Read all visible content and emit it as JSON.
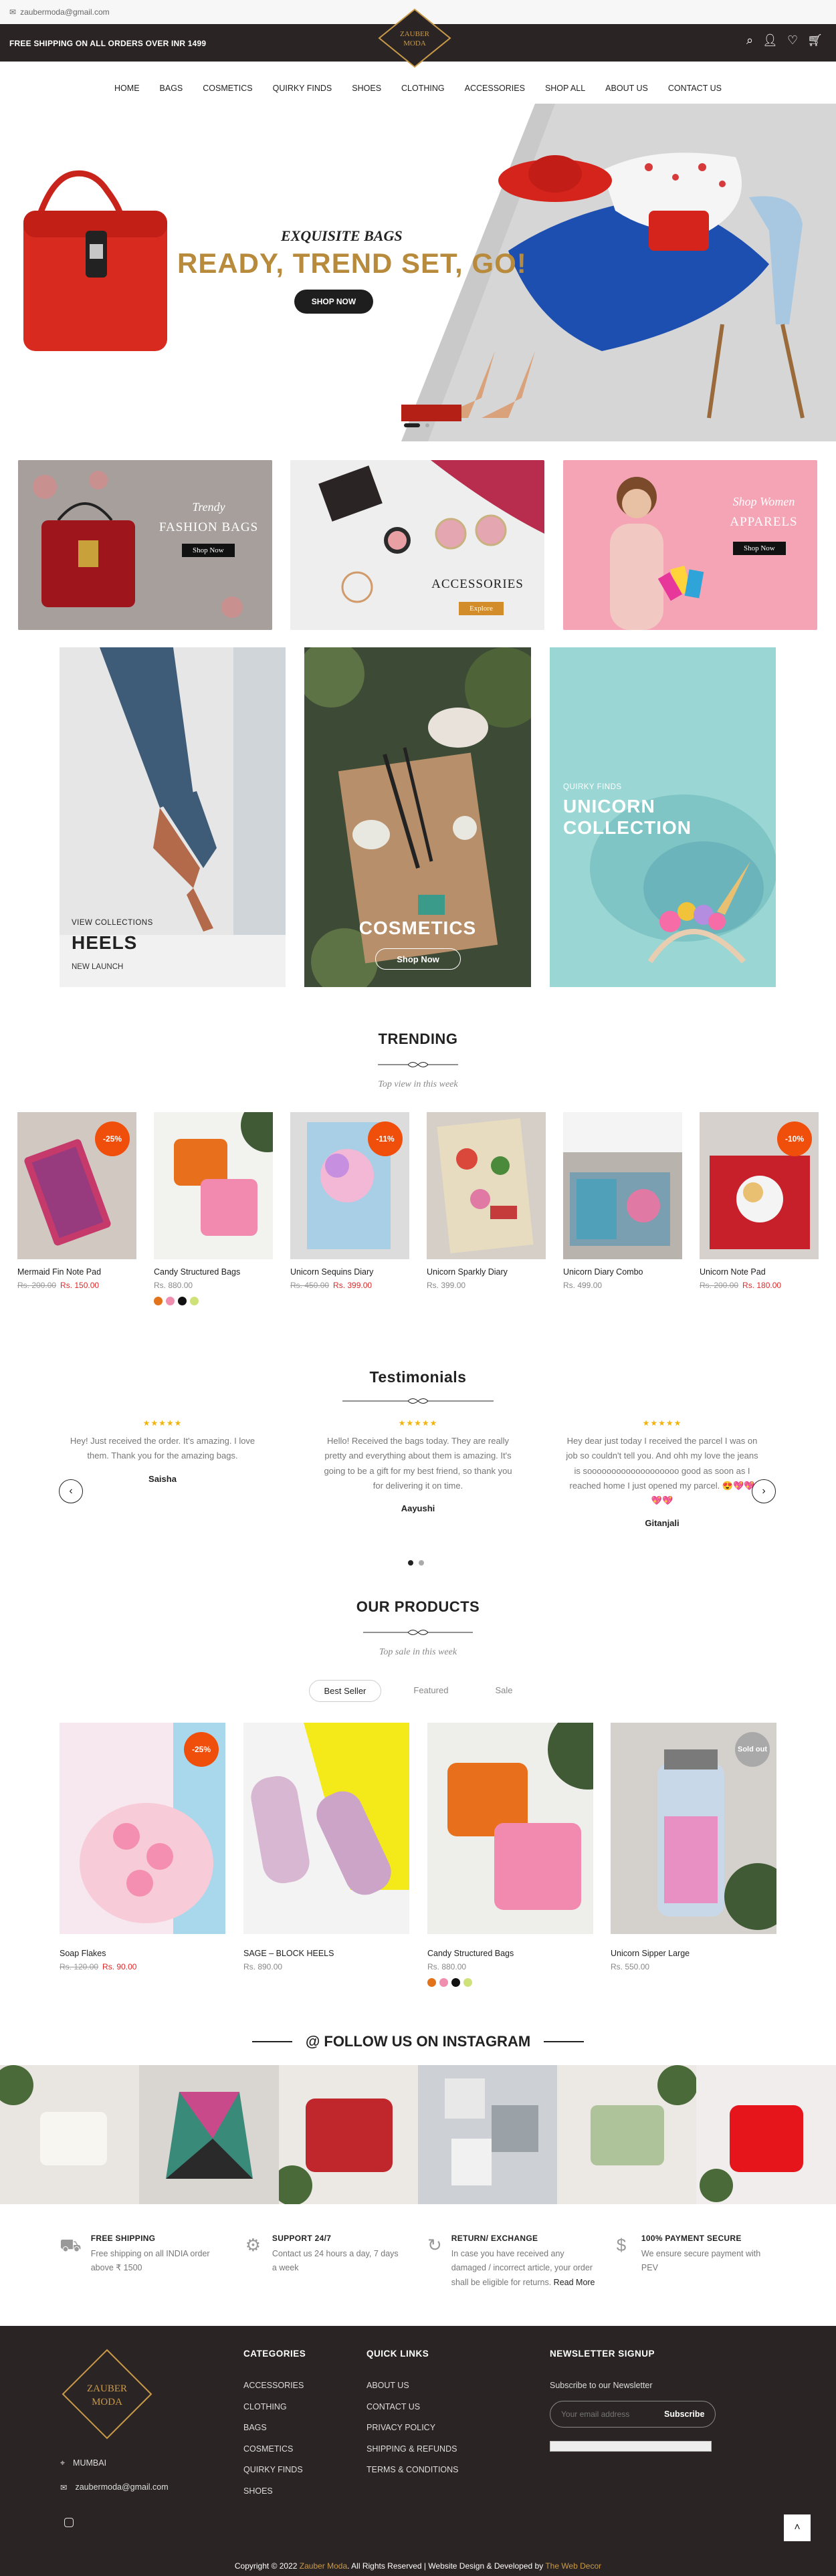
{
  "topbar": {
    "email": "zaubermoda@gmail.com"
  },
  "header": {
    "shipping": "FREE SHIPPING ON ALL ORDERS OVER INR 1499",
    "logo_line1": "ZAUBER",
    "logo_line2": "MODA",
    "wishlist_count": "0",
    "cart_count": "0"
  },
  "nav": [
    "HOME",
    "BAGS",
    "COSMETICS",
    "QUIRKY FINDS",
    "SHOES",
    "CLOTHING",
    "ACCESSORIES",
    "SHOP ALL",
    "ABOUT US",
    "CONTACT US"
  ],
  "hero": {
    "subtitle": "EXQUISITE BAGS",
    "title": "READY, TREND SET, GO!",
    "button": "SHOP NOW"
  },
  "banners": [
    {
      "script": "Trendy",
      "title": "FASHION BAGS",
      "button": "Shop Now"
    },
    {
      "title": "ACCESSORIES",
      "button": "Explore"
    },
    {
      "script": "Shop Women",
      "title": "APPARELS",
      "button": "Shop Now"
    }
  ],
  "tiles": [
    {
      "kicker": "VIEW COLLECTIONS",
      "title": "HEELS",
      "sub": "NEW LAUNCH"
    },
    {
      "title": "COSMETICS",
      "button": "Shop Now"
    },
    {
      "kicker": "QUIRKY FINDS",
      "title1": "UNICORN",
      "title2": "COLLECTION"
    }
  ],
  "trending": {
    "title": "TRENDING",
    "subtitle": "Top view in this week",
    "products": [
      {
        "name": "Mermaid Fin Note Pad",
        "old": "Rs. 200.00",
        "price": "Rs. 150.00",
        "badge": "-25%"
      },
      {
        "name": "Candy Structured Bags",
        "price": "Rs. 880.00",
        "swatches": [
          "#e2731b",
          "#f08eb0",
          "#111111",
          "#cfe27a"
        ]
      },
      {
        "name": "Unicorn Sequins Diary",
        "old": "Rs. 450.00",
        "price": "Rs. 399.00",
        "badge": "-11%"
      },
      {
        "name": "Unicorn Sparkly Diary",
        "price": "Rs. 399.00"
      },
      {
        "name": "Unicorn Diary Combo",
        "price": "Rs. 499.00"
      },
      {
        "name": "Unicorn Note Pad",
        "old": "Rs. 200.00",
        "price": "Rs. 180.00",
        "badge": "-10%"
      }
    ]
  },
  "testimonials": {
    "title": "Testimonials",
    "items": [
      {
        "text": "Hey! Just received the order. It's amazing. I love them. Thank you for the amazing bags.",
        "name": "Saisha"
      },
      {
        "text": "Hello! Received the bags today. They are really pretty and everything about them is amazing. It's going to be a gift for my best friend, so thank you for delivering it on time.",
        "name": "Aayushi"
      },
      {
        "text": "Hey dear just today I received the parcel I was on job so couldn't tell you. And ohh my love the jeans is sooooooooooooooooooo good as soon as I reached home I just opened my parcel. 😍💖💖💖💖",
        "name": "Gitanjali"
      }
    ]
  },
  "our_products": {
    "title": "OUR PRODUCTS",
    "subtitle": "Top sale in this week",
    "tabs": [
      "Best Seller",
      "Featured",
      "Sale"
    ],
    "products": [
      {
        "name": "Soap Flakes",
        "old": "Rs. 120.00",
        "price": "Rs. 90.00",
        "badge": "-25%"
      },
      {
        "name": "SAGE – BLOCK HEELS",
        "price": "Rs. 890.00"
      },
      {
        "name": "Candy Structured Bags",
        "price": "Rs. 880.00",
        "swatches": [
          "#e2731b",
          "#f08eb0",
          "#111111",
          "#cfe27a"
        ]
      },
      {
        "name": "Unicorn Sipper Large",
        "price": "Rs. 550.00",
        "badge": "Sold out"
      }
    ]
  },
  "instagram": {
    "title": "@ FOLLOW US ON INSTAGRAM"
  },
  "features": [
    {
      "icon": "truck-icon",
      "title": "FREE SHIPPING",
      "desc": "Free shipping on all INDIA order above ₹ 1500"
    },
    {
      "icon": "support-icon",
      "title": "SUPPORT 24/7",
      "desc": "Contact us 24 hours a day, 7 days a week"
    },
    {
      "icon": "return-icon",
      "title": "RETURN/ EXCHANGE",
      "desc": "In case you have received any damaged / incorrect article, your order shall be eligible for returns.",
      "link": "Read More"
    },
    {
      "icon": "payment-icon",
      "title": "100% PAYMENT SECURE",
      "desc": "We ensure secure payment with PEV"
    }
  ],
  "footer": {
    "location": "MUMBAI",
    "email": "zaubermoda@gmail.com",
    "categories_title": "CATEGORIES",
    "categories": [
      "ACCESSORIES",
      "CLOTHING",
      "BAGS",
      "COSMETICS",
      "QUIRKY FINDS",
      "SHOES"
    ],
    "quick_title": "QUICK LINKS",
    "quick": [
      "ABOUT US",
      "CONTACT US",
      "PRIVACY POLICY",
      "SHIPPING & REFUNDS",
      "TERMS & CONDITIONS"
    ],
    "news_title": "NEWSLETTER SIGNUP",
    "news_text": "Subscribe to our Newsletter",
    "news_placeholder": "Your email address",
    "news_button": "Subscribe",
    "copy_a": "Copyright © 2022 ",
    "copy_brand": "Zauber Moda",
    "copy_b": ". All Rights Reserved | Website Design & Developed by ",
    "copy_dev": "The Web Decor"
  },
  "colors": {
    "accent": "#b88a3c",
    "dark": "#2b2424",
    "sale": "#e02828",
    "badge": "#f04e0b"
  }
}
